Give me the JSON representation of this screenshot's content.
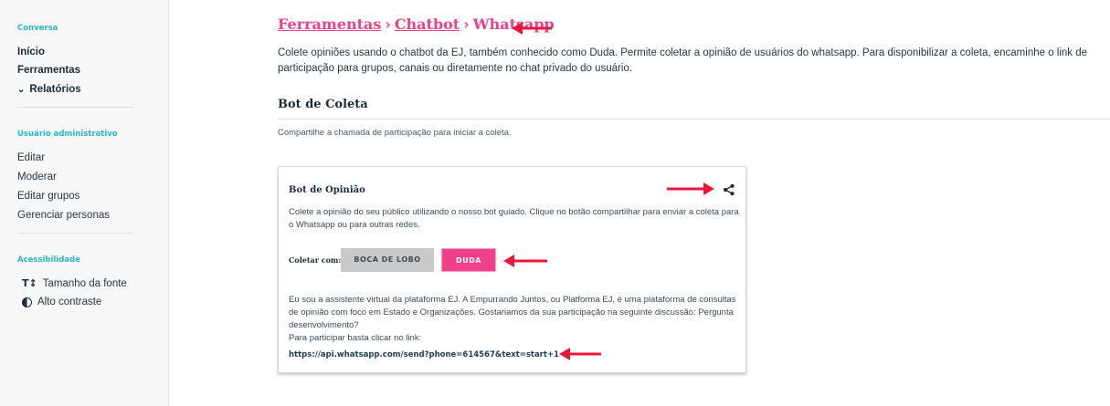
{
  "sidebar": {
    "section_conversa": "Conversa",
    "inicio": "Início",
    "ferramentas": "Ferramentas",
    "relatorios": "Relatórios",
    "section_admin": "Usuário administrativo",
    "editar": "Editar",
    "moderar": "Moderar",
    "editar_grupos": "Editar grupos",
    "gerenciar_personas": "Gerenciar personas",
    "section_acess": "Acessibilidade",
    "tamanho_fonte": "Tamanho da fonte",
    "alto_contraste": "Alto contraste"
  },
  "breadcrumb": {
    "crumb1": "Ferramentas",
    "crumb2": "Chatbot",
    "crumb3": "Whatsapp",
    "separator": "›"
  },
  "intro": "Colete opiniões usando o chatbot da EJ, também conhecido como Duda. Permite coletar a opinião de usuários do whatsapp. Para disponibilizar a coleta, encaminhe o link de participação para grupos, canais ou diretamente no chat privado do usuário.",
  "section": {
    "title": "Bot de Coleta",
    "subtitle": "Compartilhe a chamada de participação para iniciar a coleta."
  },
  "card": {
    "title": "Bot de Opinião",
    "description": "Colete a opinião do seu público utilizando o nosso bot guiado. Clique no botão compartilhar para enviar a coleta para o Whatsapp ou para outras redes.",
    "collect_label": "Coletar com:",
    "btn_boca": "BOCA DE LOBO",
    "btn_duda": "DUDA",
    "message": "Eu sou a assistente virtual da plataforma EJ. A Empurrando Juntos, ou Platforma EJ, é uma plataforma de consultas de opinião com foco em Estado e Organizações. Gostariamos da sua participação na seguinte discussão: Pergunta desenvolvimento?",
    "message_link_intro": "Para participar basta clicar no link:",
    "link": "https://api.whatsapp.com/send?phone=614567&text=start+1"
  },
  "colors": {
    "accent_pink": "#f0408a",
    "sidebar_section": "#29b6c8",
    "arrow_red": "#e8173c"
  }
}
